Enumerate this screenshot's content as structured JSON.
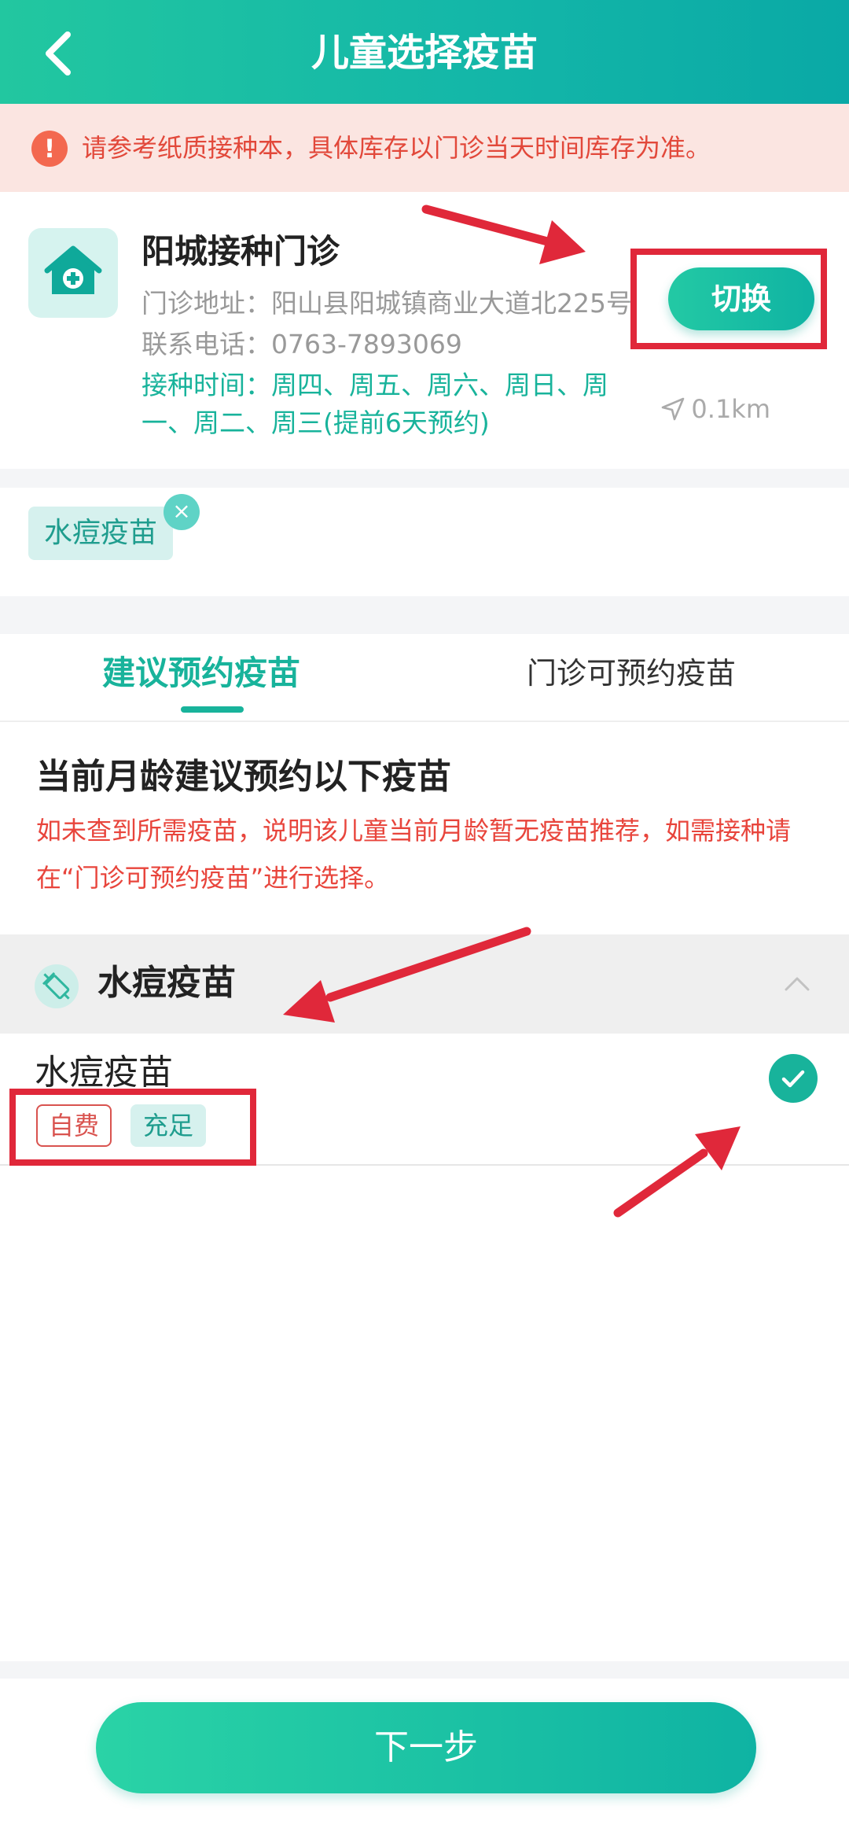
{
  "header": {
    "title": "儿童选择疫苗",
    "back_icon": "chevron-left-icon"
  },
  "notice": {
    "icon": "!",
    "text": "请参考纸质接种本，具体库存以门诊当天时间库存为准。"
  },
  "clinic": {
    "name": "阳城接种门诊",
    "address": "门诊地址：阳山县阳城镇商业大道北225号",
    "phone": "联系电话：0763-7893069",
    "hours": "接种时间：周四、周五、周六、周日、周一、周二、周三(提前6天预约)",
    "distance": "0.1km",
    "switch_label": "切换"
  },
  "selected_chip": {
    "label": "水痘疫苗",
    "close": "×"
  },
  "tabs": [
    {
      "label": "建议预约疫苗",
      "active": true
    },
    {
      "label": "门诊可预约疫苗",
      "active": false
    }
  ],
  "recommend": {
    "title": "当前月龄建议预约以下疫苗",
    "desc": "如未查到所需疫苗，说明该儿童当前月龄暂无疫苗推荐，如需接种请在“门诊可预约疫苗”进行选择。"
  },
  "group": {
    "title": "水痘疫苗",
    "expanded": true
  },
  "vaccine": {
    "name": "水痘疫苗",
    "tag_paid": "自费",
    "tag_stock": "充足",
    "selected": true
  },
  "footer": {
    "next_label": "下一步"
  },
  "colors": {
    "accent": "#18b39b",
    "warning": "#e2483a",
    "annotation": "#e0283a"
  }
}
